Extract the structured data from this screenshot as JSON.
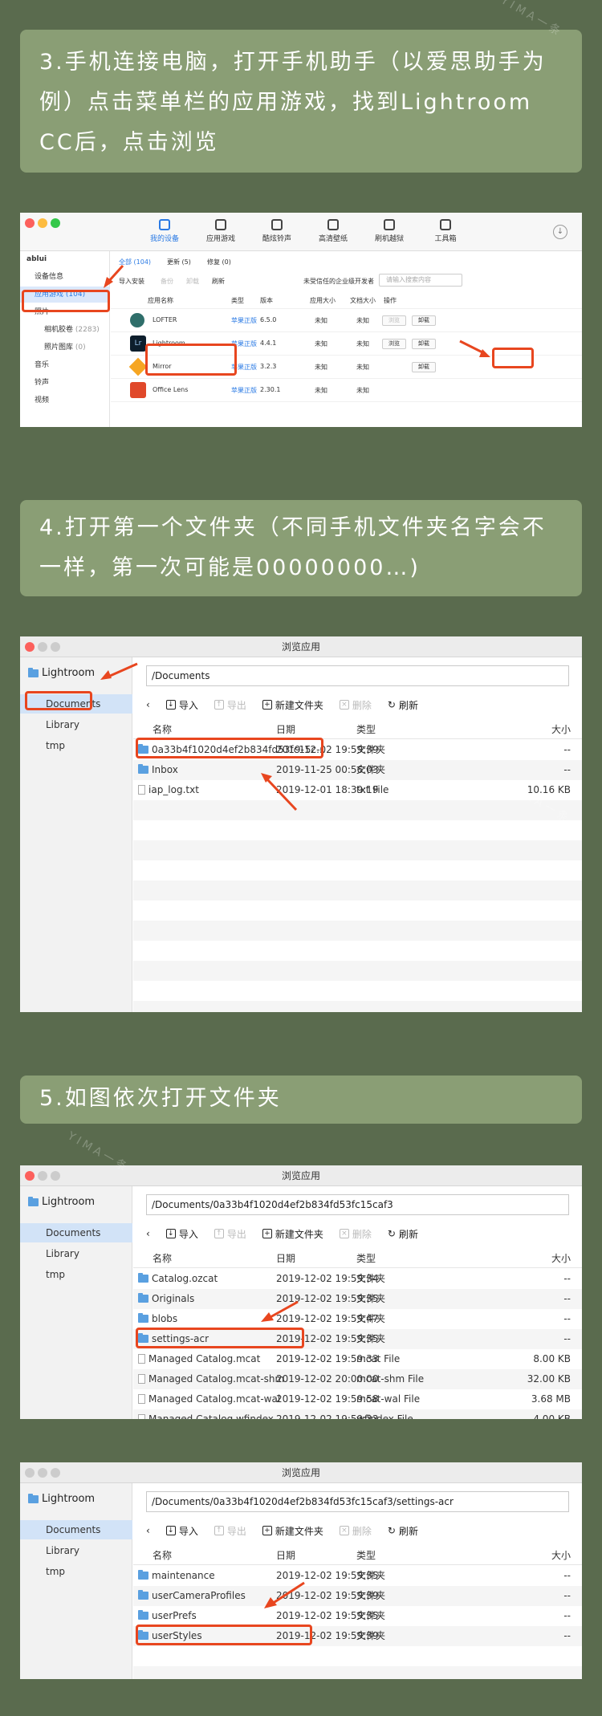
{
  "step3": {
    "text": "3.手机连接电脑，打开手机助手（以爱思助手为例）点击菜单栏的应用游戏，找到Lightroom CC后，点击浏览"
  },
  "step4": {
    "text": "4.打开第一个文件夹（不同手机文件夹名字会不一样，第一次可能是00000000…)"
  },
  "step5": {
    "text": "5.如图依次打开文件夹"
  },
  "watermark": "YIMA一条",
  "app": {
    "tabs": [
      "我的设备",
      "应用游戏",
      "酷炫铃声",
      "高清壁纸",
      "刷机越狱",
      "工具箱"
    ],
    "device": "ablui",
    "sidebar": [
      "设备信息",
      "应用游戏",
      "照片",
      "相机胶卷",
      "照片图库",
      "音乐",
      "铃声",
      "视频"
    ],
    "sidebar_counts": {
      "apps": "(104)",
      "roll": "(2283)",
      "library": "(0)"
    },
    "subtabs": [
      "全部 (104)",
      "更新 (5)",
      "修复 (0)"
    ],
    "toolbar": [
      "导入安装",
      "备份",
      "卸载",
      "刷新"
    ],
    "trust": "未受信任的企业级开发者",
    "search_placeholder": "请输入搜索内容",
    "headers": [
      "应用名称",
      "类型",
      "版本",
      "应用大小",
      "文档大小",
      "操作"
    ],
    "rows": [
      {
        "name": "LOFTER",
        "type": "苹果正版",
        "ver": "6.5.0",
        "size": "未知",
        "doc": "未知"
      },
      {
        "name": "Lightroom",
        "type": "苹果正版",
        "ver": "4.4.1",
        "size": "未知",
        "doc": "未知"
      },
      {
        "name": "Mirror",
        "type": "苹果正版",
        "ver": "3.2.3",
        "size": "未知",
        "doc": "未知"
      },
      {
        "name": "Office Lens",
        "type": "苹果正版",
        "ver": "2.30.1",
        "size": "未知",
        "doc": "未知"
      }
    ],
    "browse": "浏览",
    "uninstall": "卸载"
  },
  "fb": {
    "title": "浏览应用",
    "root": "Lightroom",
    "side": [
      "Documents",
      "Library",
      "tmp"
    ],
    "tools": [
      "导入",
      "导出",
      "新建文件夹",
      "删除",
      "刷新"
    ],
    "headers": [
      "名称",
      "日期",
      "类型",
      "大小"
    ]
  },
  "fb1": {
    "path": "/Documents",
    "rows": [
      {
        "name": "0a33b4f1020d4ef2b834fd53fc15c...",
        "date": "2019-12-02 19:59:39",
        "type": "文件夹",
        "size": "--",
        "kind": "folder"
      },
      {
        "name": "Inbox",
        "date": "2019-11-25 00:56:03",
        "type": "文件夹",
        "size": "--",
        "kind": "folder"
      },
      {
        "name": "iap_log.txt",
        "date": "2019-12-01 18:39:19",
        "type": "txt File",
        "size": "10.16 KB",
        "kind": "file"
      }
    ]
  },
  "fb2": {
    "path": "/Documents/0a33b4f1020d4ef2b834fd53fc15caf3",
    "rows": [
      {
        "name": "Catalog.ozcat",
        "date": "2019-12-02 19:59:34",
        "type": "文件夹",
        "size": "--",
        "kind": "folder"
      },
      {
        "name": "Originals",
        "date": "2019-12-02 19:59:35",
        "type": "文件夹",
        "size": "--",
        "kind": "folder"
      },
      {
        "name": "blobs",
        "date": "2019-12-02 19:59:47",
        "type": "文件夹",
        "size": "--",
        "kind": "folder"
      },
      {
        "name": "settings-acr",
        "date": "2019-12-02 19:59:35",
        "type": "文件夹",
        "size": "--",
        "kind": "folder"
      },
      {
        "name": "Managed Catalog.mcat",
        "date": "2019-12-02 19:59:33",
        "type": "mcat File",
        "size": "8.00 KB",
        "kind": "file"
      },
      {
        "name": "Managed Catalog.mcat-shm",
        "date": "2019-12-02 20:00:00",
        "type": "mcat-shm File",
        "size": "32.00 KB",
        "kind": "file"
      },
      {
        "name": "Managed Catalog.mcat-wal",
        "date": "2019-12-02 19:59:58",
        "type": "mcat-wal File",
        "size": "3.68 MB",
        "kind": "file"
      },
      {
        "name": "Managed Catalog.wfindex",
        "date": "2019-12-02 19:59:33",
        "type": "wfindex File",
        "size": "4.00 KB",
        "kind": "file"
      }
    ]
  },
  "fb3": {
    "path": "/Documents/0a33b4f1020d4ef2b834fd53fc15caf3/settings-acr",
    "rows": [
      {
        "name": "maintenance",
        "date": "2019-12-02 19:59:35",
        "type": "文件夹",
        "size": "--",
        "kind": "folder"
      },
      {
        "name": "userCameraProfiles",
        "date": "2019-12-02 19:59:39",
        "type": "文件夹",
        "size": "--",
        "kind": "folder"
      },
      {
        "name": "userPrefs",
        "date": "2019-12-02 19:59:35",
        "type": "文件夹",
        "size": "--",
        "kind": "folder"
      },
      {
        "name": "userStyles",
        "date": "2019-12-02 19:59:39",
        "type": "文件夹",
        "size": "--",
        "kind": "folder"
      }
    ]
  }
}
